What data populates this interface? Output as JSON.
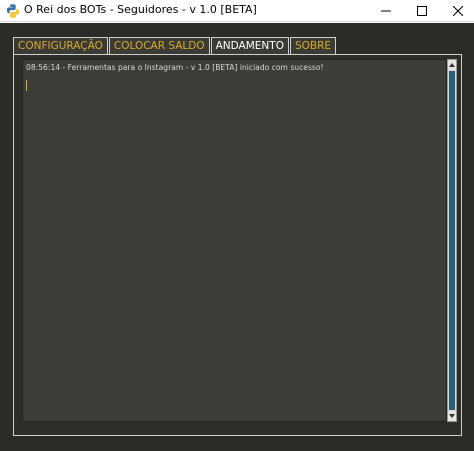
{
  "window": {
    "title": "O Rei dos BOTs - Seguidores - v 1.0 [BETA]",
    "icon": "python-icon"
  },
  "tabs": [
    {
      "label": "CONFIGURAÇÃO",
      "active": false
    },
    {
      "label": "COLOCAR SALDO",
      "active": false
    },
    {
      "label": "ANDAMENTO",
      "active": true
    },
    {
      "label": "SOBRE",
      "active": false
    }
  ],
  "log": {
    "lines": [
      "08:56:14 - Ferramentas para o Instagram - v 1.0 [BETA] iniciado com sucesso!"
    ]
  },
  "colors": {
    "tab_text": "#d9aa2e",
    "active_tab_text": "#ffffff",
    "background": "#2b2b27",
    "scroll_thumb": "#2a5f77"
  }
}
